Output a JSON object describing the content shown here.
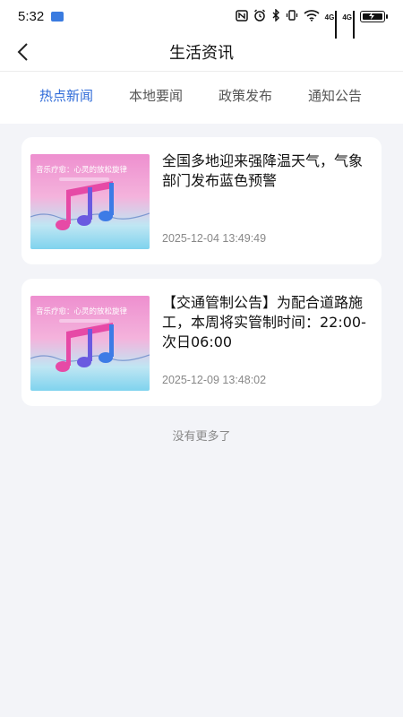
{
  "status_bar": {
    "time": "5:32",
    "signal_labels": [
      "4G",
      "4G"
    ]
  },
  "navbar": {
    "title": "生活资讯",
    "back_icon": "chevron-left-icon"
  },
  "tabs": [
    {
      "label": "热点新闻",
      "active": true
    },
    {
      "label": "本地要闻",
      "active": false
    },
    {
      "label": "政策发布",
      "active": false
    },
    {
      "label": "通知公告",
      "active": false
    }
  ],
  "news": [
    {
      "title": "全国多地迎来强降温天气，气象部门发布蓝色预警",
      "date": "2025-12-04 13:49:49",
      "thumb_caption": "音乐疗愈：心灵的放松旋律"
    },
    {
      "title": "【交通管制公告】为配合道路施工，本周将实管制时间：22:00-次日06:00",
      "date": "2025-12-09 13:48:02",
      "thumb_caption": "音乐疗愈：心灵的放松旋律"
    }
  ],
  "footer": {
    "no_more": "没有更多了"
  },
  "colors": {
    "accent": "#2f6bd8",
    "background": "#f3f4f8"
  }
}
